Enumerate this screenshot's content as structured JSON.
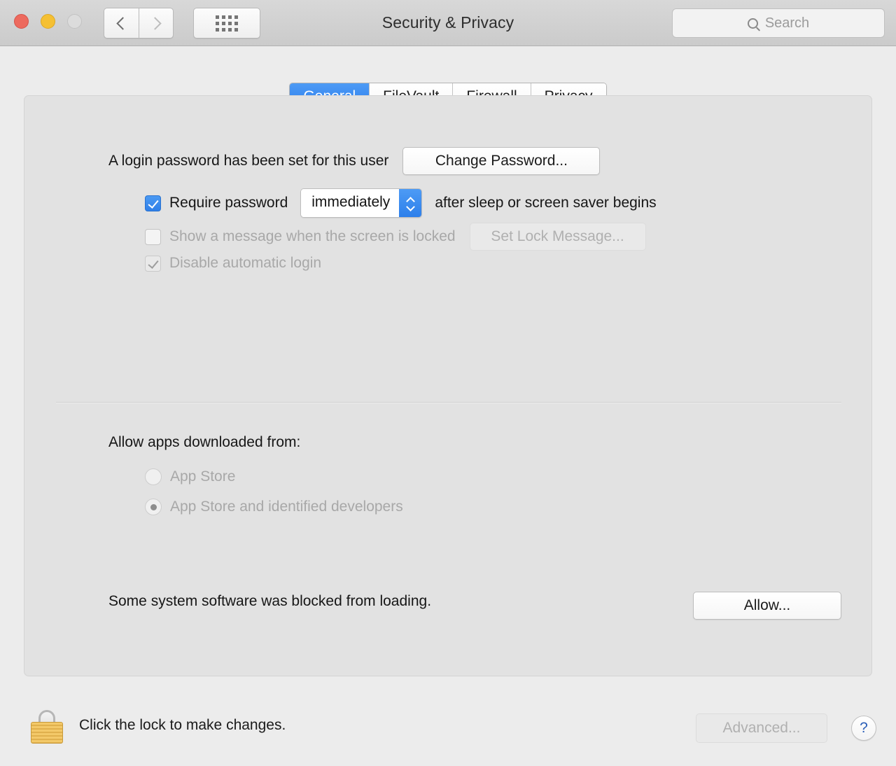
{
  "window": {
    "title": "Security & Privacy",
    "traffic_lights": [
      "close-button",
      "minimize-button",
      "zoom-button"
    ],
    "back_label": "‹",
    "forward_label": "›",
    "show_all_label": "show-all-grid"
  },
  "search": {
    "placeholder": "Search",
    "value": ""
  },
  "tabs": [
    {
      "label": "General",
      "active": true
    },
    {
      "label": "FileVault",
      "active": false
    },
    {
      "label": "Firewall",
      "active": false
    },
    {
      "label": "Privacy",
      "active": false
    }
  ],
  "general": {
    "password_status": "A login password has been set for this user",
    "change_password_button": "Change Password...",
    "require_password": {
      "label": "Require password",
      "checked": true,
      "interval_value": "immediately",
      "suffix": "after sleep or screen saver begins"
    },
    "lock_message": {
      "label": "Show a message when the screen is locked",
      "checked": false,
      "button": "Set Lock Message...",
      "disabled": true
    },
    "disable_auto_login": {
      "label": "Disable automatic login",
      "checked": true,
      "disabled": true
    },
    "allow_apps_heading": "Allow apps downloaded from:",
    "allow_apps_options": [
      {
        "label": "App Store",
        "selected": false
      },
      {
        "label": "App Store and identified developers",
        "selected": true
      }
    ],
    "blocked_software": {
      "message": "Some system software was blocked from loading.",
      "button": "Allow..."
    }
  },
  "footer": {
    "lock_icon": "closed-padlock",
    "lock_message": "Click the lock to make changes.",
    "advanced_button": "Advanced...",
    "help_button": "?"
  },
  "colors": {
    "accent_blue": "#3b82e5",
    "window_bg": "#ececec",
    "panel_bg": "#e2e2e2",
    "close_red": "#ed6a5e",
    "minimize_yellow": "#f5c033",
    "zoom_gray": "#dcdcdc",
    "lock_gold": "#f3c969",
    "help_blue": "#2b5fb8"
  }
}
